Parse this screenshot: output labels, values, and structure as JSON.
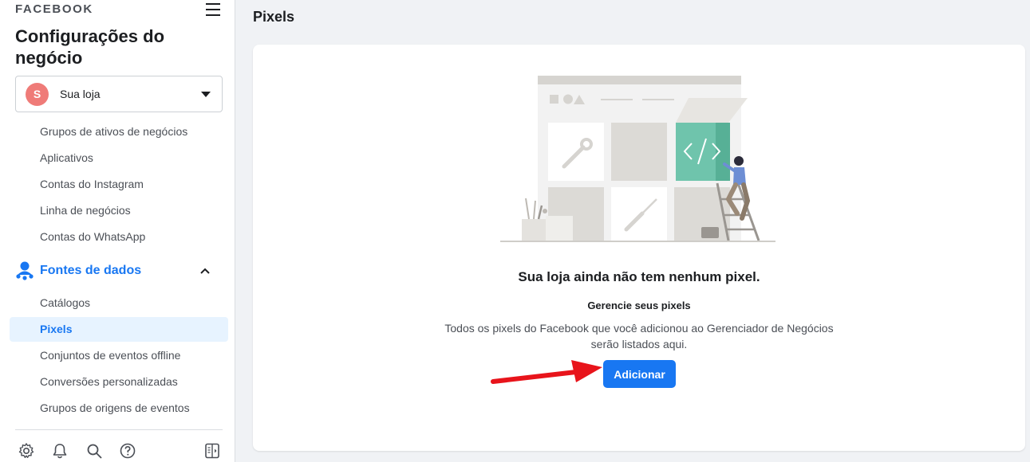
{
  "sidebar": {
    "brand": "FACEBOOK",
    "title": "Configurações do negócio",
    "business": {
      "initial": "S",
      "name": "Sua loja",
      "avatar_color": "#ef7b78"
    },
    "items": [
      {
        "label": "Grupos de ativos de negócios"
      },
      {
        "label": "Aplicativos"
      },
      {
        "label": "Contas do Instagram"
      },
      {
        "label": "Linha de negócios"
      },
      {
        "label": "Contas do WhatsApp"
      }
    ],
    "section": {
      "label": "Fontes de dados",
      "icon": "data-sources-icon",
      "expanded": true
    },
    "section_items": [
      {
        "label": "Catálogos",
        "active": false
      },
      {
        "label": "Pixels",
        "active": true
      },
      {
        "label": "Conjuntos de eventos offline",
        "active": false
      },
      {
        "label": "Conversões personalizadas",
        "active": false
      },
      {
        "label": "Grupos de origens de eventos",
        "active": false
      }
    ],
    "toolbar_icons": [
      "settings-icon",
      "notifications-bell-icon",
      "search-icon",
      "help-icon",
      "toggle-panel-icon"
    ]
  },
  "main": {
    "title": "Pixels",
    "empty_state": {
      "title": "Sua loja ainda não tem nenhum pixel.",
      "subtitle": "Gerencie seus pixels",
      "description": "Todos os pixels do Facebook que você adicionou ao Gerenciador de Negócios serão listados aqui.",
      "button_label": "Adicionar"
    }
  },
  "colors": {
    "accent": "#1877f2",
    "active_bg": "#e7f3ff",
    "annotation_arrow": "#e8141b",
    "illustration_teal": "#6fc4ac"
  }
}
